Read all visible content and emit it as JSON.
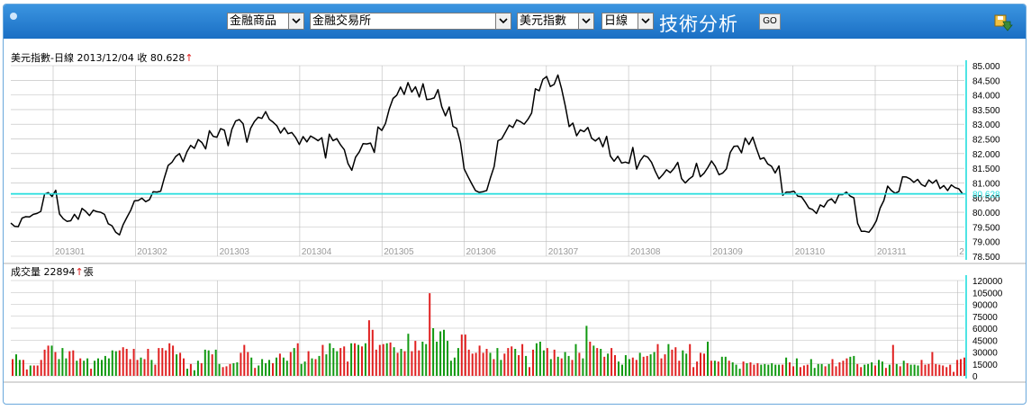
{
  "toolbar": {
    "market": "金融商品",
    "exchange": "金融交易所",
    "instrument": "美元指數",
    "period": "日線",
    "title": "技術分析",
    "go_label": "GO",
    "download_icon": "download-icon"
  },
  "price_panel": {
    "caption": "美元指數-日線  2013/12/04  收  80.628",
    "up_arrow": "↑",
    "last_label": "80.628"
  },
  "volume_panel": {
    "caption": "成交量  22894",
    "up_arrow": "↑",
    "unit": "張"
  },
  "colors": {
    "up": "#e02020",
    "down": "#119911",
    "last": "#22dddd",
    "line": "#000000",
    "grid": "#bbbbbb"
  },
  "chart_data": [
    {
      "type": "line",
      "title": "美元指數-日線",
      "ylim": [
        78.5,
        85.0
      ],
      "yticks": [
        "85.000",
        "84.500",
        "84.000",
        "83.500",
        "83.000",
        "82.500",
        "82.000",
        "81.500",
        "81.000",
        "80.500",
        "80.000",
        "79.500",
        "79.000",
        "78.500"
      ],
      "xticks": [
        "201301",
        "201302",
        "201303",
        "201304",
        "201305",
        "201306",
        "201307",
        "201308",
        "201309",
        "201310",
        "201311",
        "2"
      ],
      "grid": true,
      "last_value": 80.628,
      "series": [
        {
          "values": [
            79.63,
            79.52,
            79.51,
            79.8,
            79.85,
            79.84,
            79.93,
            79.96,
            80.03,
            80.62,
            80.67,
            80.54,
            80.75,
            79.94,
            79.78,
            79.69,
            79.71,
            79.93,
            79.76,
            80.13,
            80.03,
            79.89,
            80.07,
            80.02,
            80.0,
            79.93,
            79.61,
            79.54,
            79.32,
            79.23,
            79.58,
            79.83,
            80.07,
            80.39,
            80.4,
            80.48,
            80.36,
            80.43,
            80.7,
            80.69,
            80.72,
            81.18,
            81.6,
            81.7,
            81.9,
            82.0,
            81.72,
            82.06,
            82.28,
            82.18,
            82.48,
            82.38,
            82.16,
            82.78,
            82.59,
            82.56,
            82.85,
            82.8,
            82.27,
            82.83,
            83.11,
            83.16,
            83.02,
            82.39,
            82.86,
            83.09,
            83.24,
            83.2,
            83.43,
            83.17,
            83.07,
            82.95,
            82.7,
            82.88,
            82.68,
            82.72,
            82.55,
            82.31,
            82.58,
            82.4,
            82.6,
            82.53,
            82.44,
            82.54,
            81.85,
            82.66,
            82.44,
            82.51,
            82.3,
            82.13,
            81.66,
            81.43,
            81.88,
            82.06,
            82.34,
            82.33,
            82.36,
            82.04,
            82.91,
            82.79,
            83.03,
            83.52,
            83.88,
            83.99,
            84.27,
            84.02,
            84.42,
            84.1,
            84.28,
            83.93,
            84.38,
            83.84,
            83.86,
            83.9,
            84.18,
            83.6,
            83.29,
            83.59,
            82.93,
            82.86,
            82.37,
            81.48,
            81.22,
            80.97,
            80.74,
            80.68,
            80.7,
            80.74,
            81.18,
            81.56,
            82.44,
            82.5,
            82.73,
            82.97,
            82.89,
            83.15,
            83.09,
            83.0,
            83.17,
            83.38,
            84.21,
            84.14,
            84.53,
            84.63,
            84.29,
            84.36,
            84.68,
            84.21,
            83.61,
            82.92,
            83.04,
            82.61,
            82.81,
            82.75,
            82.89,
            82.53,
            82.43,
            82.54,
            82.23,
            82.59,
            81.92,
            81.74,
            81.91,
            81.68,
            81.71,
            81.67,
            82.21,
            81.47,
            81.76,
            81.93,
            81.88,
            81.7,
            81.39,
            81.14,
            81.28,
            81.45,
            81.35,
            81.5,
            81.7,
            81.15,
            81.0,
            81.13,
            81.23,
            81.67,
            81.21,
            81.33,
            81.52,
            81.75,
            81.57,
            81.28,
            81.34,
            81.48,
            82.04,
            82.25,
            82.26,
            82.03,
            82.53,
            82.31,
            82.56,
            82.17,
            81.81,
            81.86,
            81.65,
            81.57,
            81.34,
            81.58,
            80.58,
            80.69,
            80.69,
            80.72,
            80.55,
            80.53,
            80.35,
            80.14,
            80.09,
            79.96,
            80.25,
            80.18,
            80.39,
            80.46,
            80.31,
            80.6,
            80.6,
            80.69,
            80.55,
            80.49,
            79.62,
            79.35,
            79.35,
            79.32,
            79.48,
            79.71,
            80.14,
            80.4,
            80.89,
            80.74,
            80.65,
            80.71,
            81.21,
            81.2,
            81.14,
            81.02,
            81.12,
            80.95,
            80.88,
            81.1,
            80.99,
            81.1,
            80.81,
            80.91,
            80.74,
            80.93,
            80.84,
            80.8,
            80.63
          ]
        }
      ]
    },
    {
      "type": "bar",
      "title": "成交量",
      "ylim": [
        0,
        120000
      ],
      "yticks": [
        "120000",
        "105000",
        "90000",
        "75000",
        "60000",
        "45000",
        "30000",
        "15000",
        "0"
      ],
      "last_value": 22894,
      "series": [
        {
          "name": "成交量",
          "values": [
            21000,
            27000,
            20000,
            20000,
            8000,
            13000,
            13000,
            13000,
            20000,
            33000,
            38000,
            38000,
            30000,
            21000,
            35000,
            22000,
            31000,
            32000,
            19000,
            22000,
            19000,
            22000,
            9000,
            19000,
            22000,
            20000,
            25000,
            22000,
            32000,
            31000,
            32000,
            36000,
            34000,
            21000,
            34000,
            20000,
            23000,
            21000,
            34000,
            20000,
            14000,
            35000,
            35000,
            32000,
            41000,
            38000,
            27000,
            29000,
            22000,
            9000,
            15000,
            7000,
            19000,
            16000,
            33000,
            32000,
            27000,
            33000,
            15000,
            11000,
            12000,
            15000,
            16000,
            17000,
            29000,
            39000,
            30000,
            23000,
            10000,
            13000,
            21000,
            16000,
            20000,
            16000,
            23000,
            28000,
            23000,
            19000,
            30000,
            35000,
            41000,
            15000,
            18000,
            31000,
            22000,
            21000,
            25000,
            39000,
            27000,
            41000,
            35000,
            31000,
            35000,
            37000,
            18000,
            41000,
            41000,
            39000,
            37000,
            41000,
            70000,
            58000,
            33000,
            39000,
            40000,
            41000,
            42000,
            36000,
            29000,
            34000,
            31000,
            53000,
            31000,
            44000,
            32000,
            43000,
            40000,
            104000,
            60000,
            43000,
            56000,
            58000,
            44000,
            19000,
            23000,
            35000,
            52000,
            52000,
            33000,
            28000,
            29000,
            38000,
            29000,
            34000,
            29000,
            21000,
            35000,
            20000,
            28000,
            35000,
            37000,
            34000,
            26000,
            40000,
            25000,
            11000,
            33000,
            41000,
            43000,
            32000,
            35000,
            21000,
            33000,
            24000,
            22000,
            30000,
            25000,
            20000,
            40000,
            29000,
            22000,
            63000,
            43000,
            38000,
            35000,
            34000,
            24000,
            28000,
            35000,
            26000,
            18000,
            14000,
            26000,
            21000,
            23000,
            20000,
            29000,
            24000,
            25000,
            27000,
            30000,
            40000,
            22000,
            27000,
            40000,
            33000,
            36000,
            19000,
            32000,
            28000,
            40000,
            11000,
            18000,
            29000,
            28000,
            43000,
            19000,
            19000,
            18000,
            24000,
            24000,
            19000,
            17000,
            14000,
            9000,
            18000,
            16000,
            17000,
            14000,
            16000,
            14000,
            15000,
            14000,
            16000,
            14000,
            14000,
            14000,
            23000,
            17000,
            12000,
            22000,
            11000,
            13000,
            14000,
            21000,
            10000,
            15000,
            15000,
            12000,
            15000,
            21000,
            12000,
            17000,
            19000,
            22000,
            24000,
            25000,
            15000,
            11000,
            14000,
            15000,
            17000,
            13000,
            20000,
            18000,
            10000,
            14000,
            39000,
            15000,
            12000,
            19000,
            16000,
            14000,
            14000,
            13000,
            20000,
            14000,
            15000,
            30000,
            15000,
            14000,
            13000,
            11000,
            14000,
            5000,
            20000,
            21000,
            23000
          ]
        }
      ]
    }
  ]
}
